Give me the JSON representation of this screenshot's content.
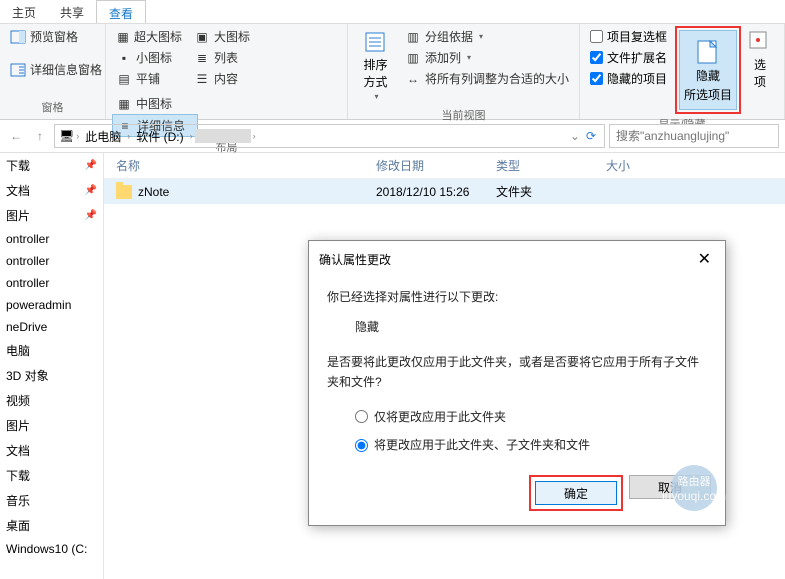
{
  "tabs": {
    "home": "主页",
    "share": "共享",
    "view": "查看"
  },
  "ribbon": {
    "panes": {
      "preview": "预览窗格",
      "details": "详细信息窗格",
      "label": "窗格"
    },
    "layout": {
      "extra_large": "超大图标",
      "large": "大图标",
      "medium": "中图标",
      "small": "小图标",
      "list": "列表",
      "details": "详细信息",
      "tiles": "平铺",
      "content": "内容",
      "label": "布局"
    },
    "current_view": {
      "sort": "排序方式",
      "group_by": "分组依据",
      "add_columns": "添加列",
      "size_all": "将所有列调整为合适的大小",
      "label": "当前视图"
    },
    "show_hide": {
      "item_check": "项目复选框",
      "file_ext": "文件扩展名",
      "hidden_items": "隐藏的项目",
      "hide_selected_l1": "隐藏",
      "hide_selected_l2": "所选项目",
      "options": "选项",
      "label": "显示/隐藏"
    }
  },
  "breadcrumb": {
    "this_pc": "此电脑",
    "drive": "软件 (D:)",
    "folder": ""
  },
  "search_placeholder": "搜索\"anzhuanglujing\"",
  "columns": {
    "name": "名称",
    "date": "修改日期",
    "type": "类型",
    "size": "大小"
  },
  "files": [
    {
      "name": "zNote",
      "date": "2018/12/10 15:26",
      "type": "文件夹",
      "size": ""
    }
  ],
  "sidebar": {
    "items": [
      {
        "label": "下载",
        "pinned": true
      },
      {
        "label": "文档",
        "pinned": true
      },
      {
        "label": "图片",
        "pinned": true
      },
      {
        "label": "ontroller",
        "pinned": false
      },
      {
        "label": "ontroller",
        "pinned": false
      },
      {
        "label": "ontroller",
        "pinned": false
      },
      {
        "label": "poweradmin",
        "pinned": false
      },
      {
        "label": "neDrive",
        "pinned": false
      },
      {
        "label": "电脑",
        "pinned": false
      },
      {
        "label": "3D 对象",
        "pinned": false
      },
      {
        "label": "视频",
        "pinned": false
      },
      {
        "label": "图片",
        "pinned": false
      },
      {
        "label": "文档",
        "pinned": false
      },
      {
        "label": "下载",
        "pinned": false
      },
      {
        "label": "音乐",
        "pinned": false
      },
      {
        "label": "桌面",
        "pinned": false
      },
      {
        "label": "Windows10 (C:",
        "pinned": false
      }
    ]
  },
  "dialog": {
    "title": "确认属性更改",
    "line1": "你已经选择对属性进行以下更改:",
    "attr": "隐藏",
    "question": "是否要将此更改仅应用于此文件夹，或者是否要将它应用于所有子文件夹和文件?",
    "opt1": "仅将更改应用于此文件夹",
    "opt2": "将更改应用于此文件夹、子文件夹和文件",
    "ok": "确定",
    "cancel": "取消"
  },
  "watermark": {
    "cn": "路由器",
    "py": "luyouqi.com"
  }
}
